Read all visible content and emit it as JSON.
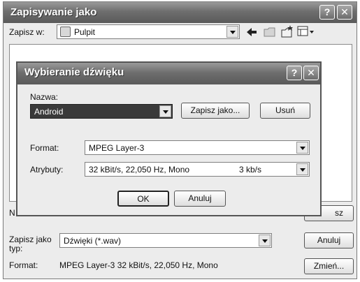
{
  "save_dialog": {
    "title": "Zapisywanie jako",
    "save_in_label": "Zapisz w:",
    "save_in_value": "Pulpit",
    "filename_label_partial": "N",
    "save_button_partial": "sz",
    "save_as_type_label": "Zapisz jako typ:",
    "save_as_type_value": "Dźwięki (*.wav)",
    "cancel_label": "Anuluj",
    "format_label": "Format:",
    "format_value": "MPEG Layer-3 32 kBit/s, 22,050 Hz, Mono",
    "change_label": "Zmień..."
  },
  "sound_dialog": {
    "title": "Wybieranie dźwięku",
    "name_label": "Nazwa:",
    "name_value": "Android",
    "save_as_label": "Zapisz jako...",
    "delete_label": "Usuń",
    "format_label": "Format:",
    "format_value": "MPEG Layer-3",
    "attributes_label": "Atrybuty:",
    "attributes_value": "32 kBit/s, 22,050 Hz, Mono",
    "attributes_rate": "3 kb/s",
    "ok_label": "OK",
    "cancel_label": "Anuluj"
  },
  "titlebar_buttons": {
    "help": "?",
    "close": "✕"
  }
}
